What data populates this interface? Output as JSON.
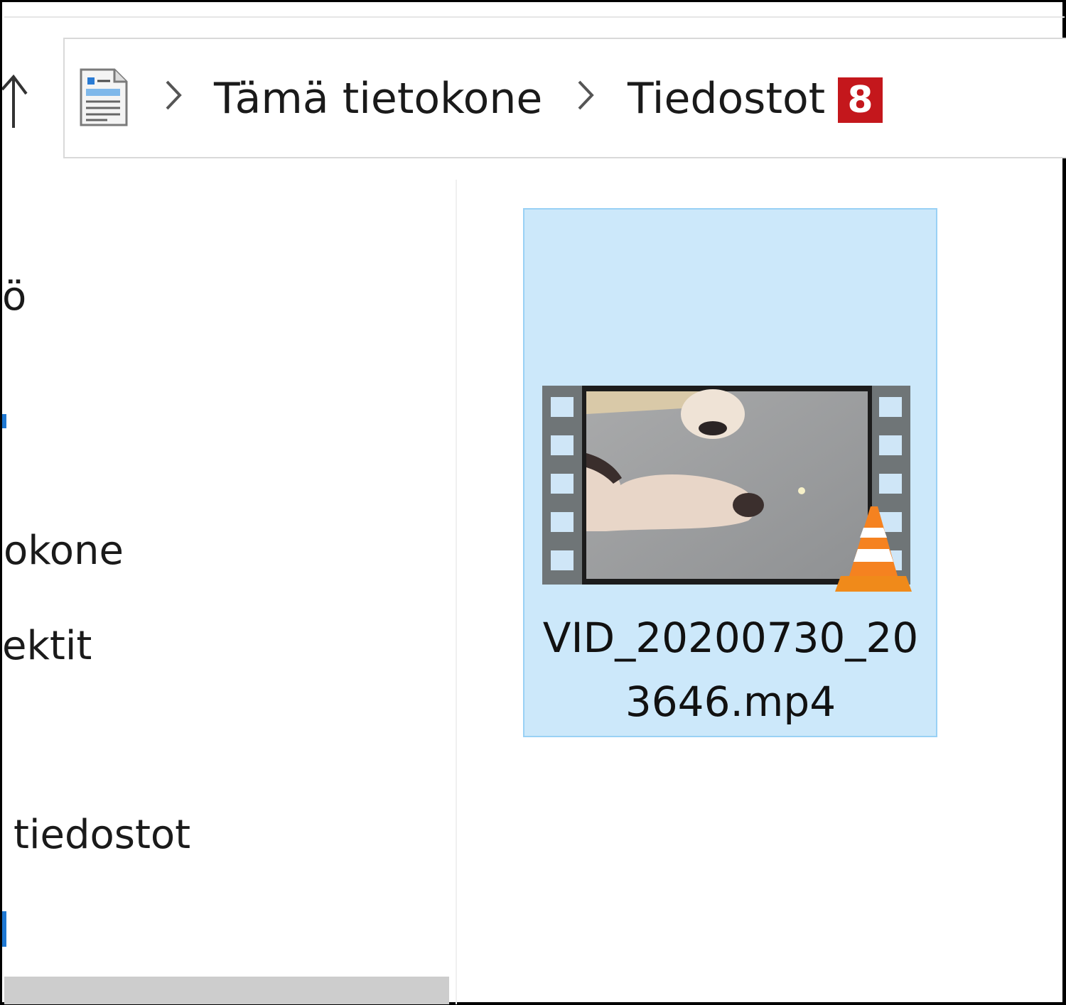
{
  "address_bar": {
    "crumbs": [
      "Tämä tietokone",
      "Tiedostot"
    ],
    "badge": "8",
    "badge_color": "#c4171c",
    "icons": {
      "up": "up-arrow-icon",
      "location": "document-icon",
      "separator": "chevron-right-icon"
    }
  },
  "nav_pane": {
    "items": [
      "ö",
      "okone",
      "ektit",
      "tiedostot"
    ]
  },
  "files": [
    {
      "name_line1": "VID_20200730_20",
      "name_line2": "3646.mp4",
      "selected": true,
      "icon": "vlc-cone-icon",
      "selection_color": "#cce8fa"
    }
  ]
}
